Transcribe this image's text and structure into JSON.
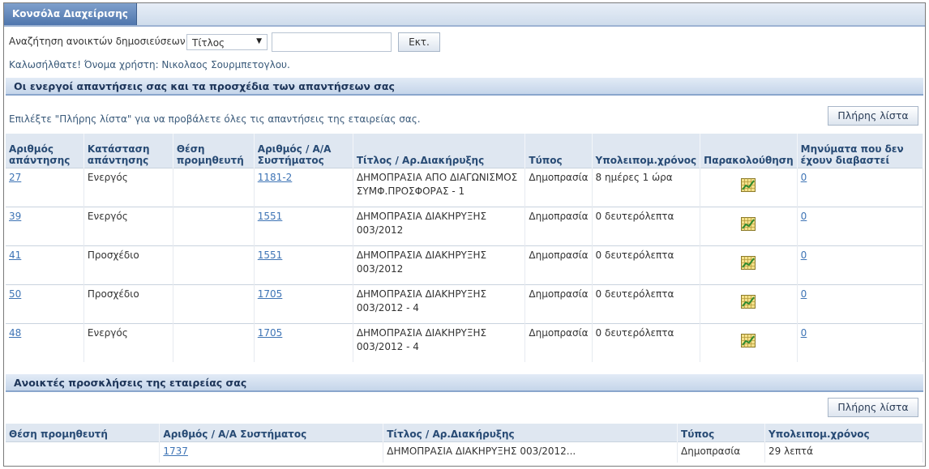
{
  "tab": {
    "label": "Κονσόλα Διαχείρισης"
  },
  "search": {
    "label": "Αναζήτηση ανοικτών δημοσιεύσεων",
    "select_value": "Τίτλος",
    "input_value": "",
    "go_label": "Εκτ."
  },
  "welcome": "Καλωσήλθατε! Όνομα χρήστη: Νικολαος Σουρμπετογλου.",
  "responses": {
    "title": "Οι ενεργοί απαντήσεις σας και τα προσχέδια των απαντήσεων σας",
    "hint": "Επιλέξτε \"Πλήρης λίστα\" για να προβάλετε όλες τις απαντήσεις της εταιρείας σας.",
    "full_list_label": "Πλήρης λίστα",
    "columns": [
      "Αριθμός απάντησης",
      "Κατάσταση απάντησης",
      "Θέση προμηθευτή",
      "Αριθμός / Α/Α Συστήματος",
      "Τίτλος / Αρ.Διακήρυξης",
      "Τύπος",
      "Υπολειπομ.χρόνος",
      "Παρακολούθηση",
      "Μηνύματα που δεν έχουν διαβαστεί"
    ],
    "rows": [
      {
        "num": "27",
        "status": "Ενεργός",
        "position": "",
        "sys": "1181-2",
        "title": "ΔΗΜΟΠΡΑΣΙΑ ΑΠΟ ΔΙΑΓΩΝΙΣΜΟΣ ΣΥΜΦ.ΠΡΟΣΦΟΡΑΣ - 1",
        "type": "Δημοπρασία",
        "remaining": "8 ημέρες 1 ώρα",
        "monitor_icon": "monitor-chart-icon",
        "unread": "0"
      },
      {
        "num": "39",
        "status": "Ενεργός",
        "position": "",
        "sys": "1551",
        "title": "ΔΗΜΟΠΡΑΣΙΑ ΔΙΑΚΗΡΥΞΗΣ 003/2012",
        "type": "Δημοπρασία",
        "remaining": "0 δευτερόλεπτα",
        "monitor_icon": "monitor-chart-icon",
        "unread": "0"
      },
      {
        "num": "41",
        "status": "Προσχέδιο",
        "position": "",
        "sys": "1551",
        "title": "ΔΗΜΟΠΡΑΣΙΑ ΔΙΑΚΗΡΥΞΗΣ 003/2012",
        "type": "Δημοπρασία",
        "remaining": "0 δευτερόλεπτα",
        "monitor_icon": "monitor-chart-icon",
        "unread": "0"
      },
      {
        "num": "50",
        "status": "Προσχέδιο",
        "position": "",
        "sys": "1705",
        "title": "ΔΗΜΟΠΡΑΣΙΑ ΔΙΑΚΗΡΥΞΗΣ 003/2012 - 4",
        "type": "Δημοπρασία",
        "remaining": "0 δευτερόλεπτα",
        "monitor_icon": "monitor-chart-icon",
        "unread": "0"
      },
      {
        "num": "48",
        "status": "Ενεργός",
        "position": "",
        "sys": "1705",
        "title": "ΔΗΜΟΠΡΑΣΙΑ ΔΙΑΚΗΡΥΞΗΣ 003/2012 - 4",
        "type": "Δημοπρασία",
        "remaining": "0 δευτερόλεπτα",
        "monitor_icon": "monitor-chart-icon",
        "unread": "0"
      }
    ]
  },
  "invitations": {
    "title": "Ανοικτές προσκλήσεις της εταιρείας σας",
    "full_list_label": "Πλήρης λίστα",
    "columns": [
      "Θέση προμηθευτή",
      "Αριθμός / Α/Α Συστήματος",
      "Τίτλος / Αρ.Διακήρυξης",
      "Τύπος",
      "Υπολειπομ.χρόνος"
    ],
    "rows": [
      {
        "position": "",
        "sys": "1737",
        "title": "ΔΗΜΟΠΡΑΣΙΑ ΔΙΑΚΗΡΥΞΗΣ 003/2012...",
        "type": "Δημοπρασία",
        "remaining": "29 λεπτά"
      }
    ]
  },
  "colors": {
    "link": "#3e74b5",
    "header_text": "#274a74",
    "tab": "#4f76ad"
  }
}
